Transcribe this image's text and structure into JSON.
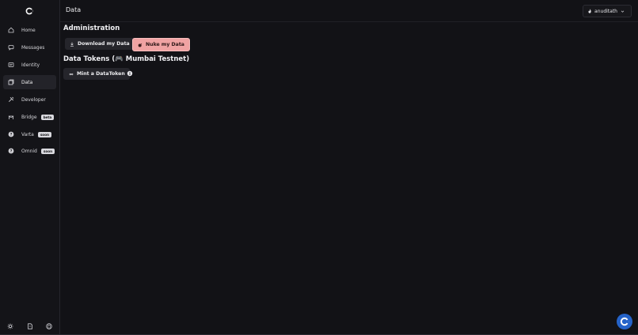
{
  "header": {
    "title": "Data",
    "user": "anuditath"
  },
  "sidebar": {
    "items": [
      {
        "label": "Home",
        "icon": "home-icon"
      },
      {
        "label": "Messages",
        "icon": "messages-icon"
      },
      {
        "label": "Identity",
        "icon": "identity-icon"
      },
      {
        "label": "Data",
        "icon": "data-icon",
        "active": true
      },
      {
        "label": "Developer",
        "icon": "developer-icon"
      },
      {
        "label": "Bridge",
        "icon": "bridge-icon",
        "badge": "beta"
      },
      {
        "label": "Varta",
        "icon": "help-icon",
        "badge": "soon"
      },
      {
        "label": "Omnid",
        "icon": "help-icon",
        "badge": "soon"
      }
    ],
    "bottom_icons": [
      "sun-icon",
      "document-icon",
      "github-icon"
    ]
  },
  "main": {
    "admin_title": "Administration",
    "download_label": "Download my Data",
    "nuke_label": "Nuke my Data",
    "tokens_title": "Data Tokens (🎮 Mumbai Testnet)",
    "mint_label": "Mint a DataToken"
  },
  "colors": {
    "background": "#121216",
    "sidebar": "#141418",
    "nuke_button": "#f0a3a3",
    "fab": "#2563c9"
  }
}
